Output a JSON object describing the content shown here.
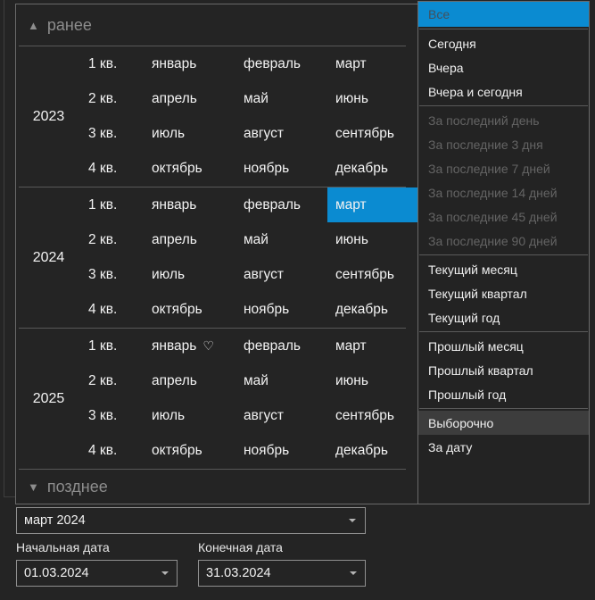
{
  "colors": {
    "accent_blue": "#0b8bd1",
    "selected_item_bg": "#3d3d3d",
    "background": "#242424"
  },
  "calendar": {
    "earlier_label": "ранее",
    "later_label": "позднее",
    "years": [
      "2023",
      "2024",
      "2025"
    ],
    "quarters": [
      "1 кв.",
      "2 кв.",
      "3 кв.",
      "4 кв."
    ],
    "months": [
      [
        "январь",
        "февраль",
        "март"
      ],
      [
        "апрель",
        "май",
        "июнь"
      ],
      [
        "июль",
        "август",
        "сентябрь"
      ],
      [
        "октябрь",
        "ноябрь",
        "декабрь"
      ]
    ],
    "selected_month": {
      "year": "2024",
      "row": 0,
      "col": 2,
      "label": "март"
    },
    "month_marker": {
      "year": "2025",
      "row": 0,
      "col": 0,
      "text": "♡"
    }
  },
  "menu": {
    "items": [
      {
        "label": "Все",
        "state": "hover",
        "separator_before": false
      },
      {
        "label": "Сегодня",
        "state": "normal",
        "separator_before": true
      },
      {
        "label": "Вчера",
        "state": "normal",
        "separator_before": false
      },
      {
        "label": "Вчера и сегодня",
        "state": "normal",
        "separator_before": false
      },
      {
        "label": "За последний день",
        "state": "disabled",
        "separator_before": true
      },
      {
        "label": "За последние 3 дня",
        "state": "disabled",
        "separator_before": false
      },
      {
        "label": "За последние 7 дней",
        "state": "disabled",
        "separator_before": false
      },
      {
        "label": "За последние 14 дней",
        "state": "disabled",
        "separator_before": false
      },
      {
        "label": "За последние 45 дней",
        "state": "disabled",
        "separator_before": false
      },
      {
        "label": "За последние 90 дней",
        "state": "disabled",
        "separator_before": false
      },
      {
        "label": "Текущий месяц",
        "state": "normal",
        "separator_before": true
      },
      {
        "label": "Текущий квартал",
        "state": "normal",
        "separator_before": false
      },
      {
        "label": "Текущий год",
        "state": "normal",
        "separator_before": false
      },
      {
        "label": "Прошлый месяц",
        "state": "normal",
        "separator_before": true
      },
      {
        "label": "Прошлый квартал",
        "state": "normal",
        "separator_before": false
      },
      {
        "label": "Прошлый год",
        "state": "normal",
        "separator_before": false
      },
      {
        "label": "Выборочно",
        "state": "selected",
        "separator_before": true
      },
      {
        "label": "За дату",
        "state": "normal",
        "separator_before": false
      }
    ]
  },
  "period_combo": {
    "value": "март 2024"
  },
  "dates": {
    "start": {
      "label": "Начальная дата",
      "value": "01.03.2024"
    },
    "end": {
      "label": "Конечная дата",
      "value": "31.03.2024"
    }
  }
}
